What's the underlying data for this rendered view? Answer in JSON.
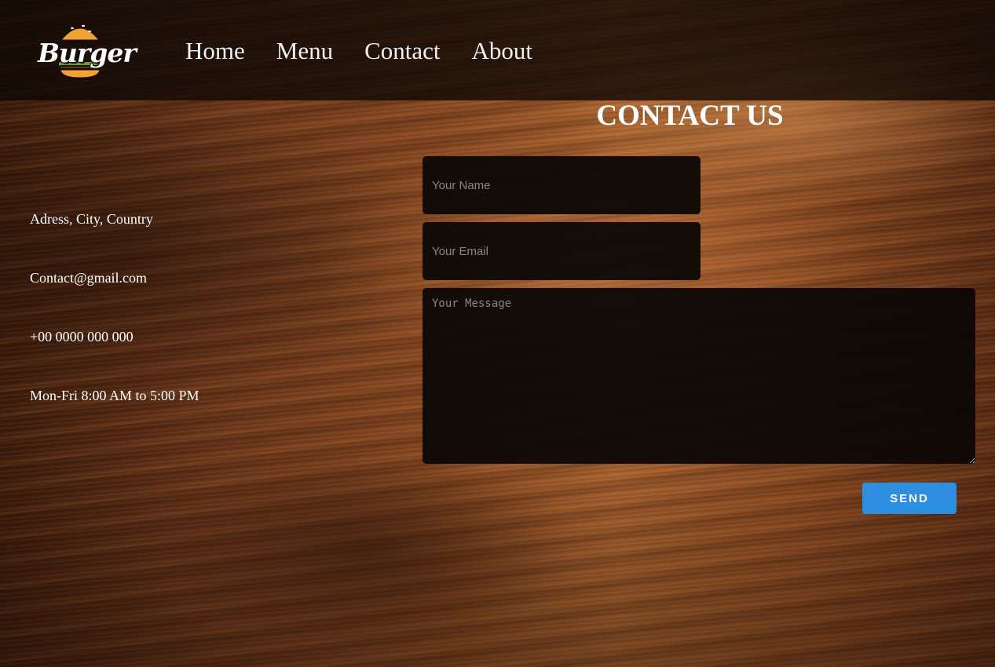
{
  "header": {
    "logo_text": "Burger",
    "nav": [
      {
        "label": "Home"
      },
      {
        "label": "Menu"
      },
      {
        "label": "Contact"
      },
      {
        "label": "About"
      }
    ]
  },
  "main": {
    "title": "CONTACT US",
    "info": {
      "address": "Adress, City, Country",
      "email": "Contact@gmail.com",
      "phone": "+00 0000 000 000",
      "hours": "Mon-Fri 8:00 AM to 5:00 PM"
    },
    "form": {
      "name_placeholder": "Your Name",
      "email_placeholder": "Your Email",
      "message_placeholder": "Your Message",
      "send_label": "SEND"
    }
  },
  "colors": {
    "accent": "#2e8fe0",
    "field_bg": "#0a0604",
    "text": "#ffffff"
  },
  "icons": [
    "burger-logo-icon"
  ]
}
